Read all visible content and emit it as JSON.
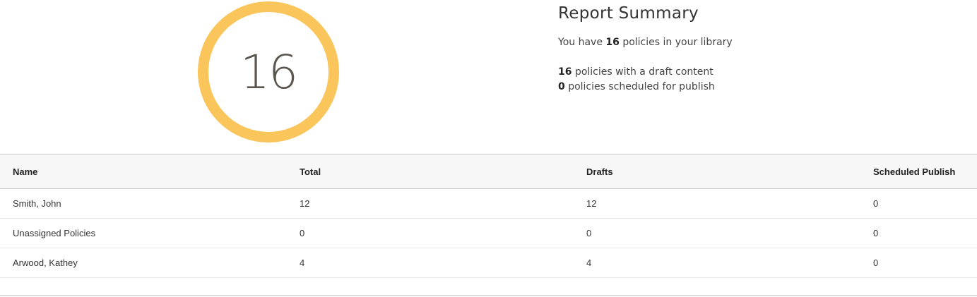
{
  "ring": {
    "count": "16",
    "color": "#fac55b"
  },
  "summary": {
    "title": "Report Summary",
    "library_prefix": "You have",
    "library_count": "16",
    "library_suffix": "policies in your library",
    "drafts_count": "16",
    "drafts_suffix": "policies with a draft content",
    "scheduled_count": "0",
    "scheduled_suffix": "policies scheduled for publish"
  },
  "table": {
    "headers": [
      "Name",
      "Total",
      "Drafts",
      "Scheduled Publish"
    ],
    "rows": [
      {
        "name": "Smith, John",
        "total": "12",
        "drafts": "12",
        "scheduled": "0"
      },
      {
        "name": "Unassigned Policies",
        "total": "0",
        "drafts": "0",
        "scheduled": "0"
      },
      {
        "name": "Arwood, Kathey",
        "total": "4",
        "drafts": "4",
        "scheduled": "0"
      }
    ]
  }
}
